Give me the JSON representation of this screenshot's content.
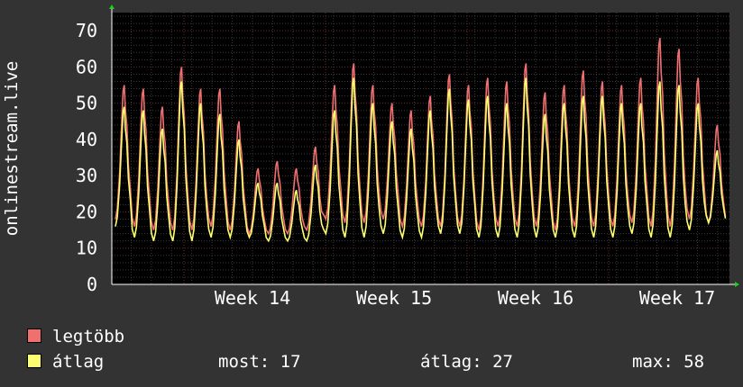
{
  "ylabel": "onlinestream.live",
  "legend": [
    {
      "name": "legtöbb",
      "color": "#f07070"
    },
    {
      "name": "átlag",
      "color": "#ffff70"
    }
  ],
  "stats": {
    "most": "most: 17",
    "atlag": "átlag: 27",
    "max": "max: 58"
  },
  "chart_data": {
    "type": "line",
    "ylabel": "onlinestream.live",
    "ylim": [
      0,
      75
    ],
    "yticks": [
      0,
      10,
      20,
      30,
      40,
      50,
      60,
      70
    ],
    "xtick_labels": [
      "Week 14",
      "Week 15",
      "Week 16",
      "Week 17"
    ],
    "grid": true,
    "background": "#000000",
    "legend_position": "bottom",
    "series": [
      {
        "name": "legtöbb",
        "color": "#f07070",
        "daily_peaks": [
          55,
          54,
          49,
          60,
          54,
          54,
          45,
          32,
          34,
          32,
          38,
          55,
          61,
          55,
          50,
          48,
          52,
          58,
          55,
          57,
          56,
          61,
          53,
          55,
          59,
          56,
          55,
          57,
          68,
          65,
          57,
          44
        ],
        "daily_lows": [
          18,
          16,
          15,
          15,
          15,
          16,
          15,
          14,
          14,
          14,
          15,
          18,
          17,
          17,
          18,
          16,
          16,
          16,
          16,
          15,
          16,
          16,
          16,
          15,
          16,
          16,
          16,
          17,
          16,
          16,
          18,
          17
        ]
      },
      {
        "name": "átlag",
        "color": "#ffff70",
        "daily_peaks": [
          49,
          48,
          43,
          56,
          50,
          47,
          40,
          28,
          28,
          26,
          33,
          48,
          57,
          50,
          45,
          43,
          48,
          54,
          51,
          52,
          50,
          57,
          47,
          50,
          52,
          52,
          50,
          50,
          56,
          55,
          50,
          37
        ],
        "daily_lows": [
          16,
          13,
          12,
          12,
          12,
          13,
          13,
          13,
          12,
          12,
          12,
          14,
          13,
          13,
          14,
          13,
          13,
          14,
          14,
          13,
          13,
          13,
          13,
          13,
          13,
          13,
          13,
          14,
          13,
          13,
          15,
          17
        ]
      }
    ],
    "summary": {
      "most": 17,
      "atlag": 27,
      "max": 58
    }
  }
}
